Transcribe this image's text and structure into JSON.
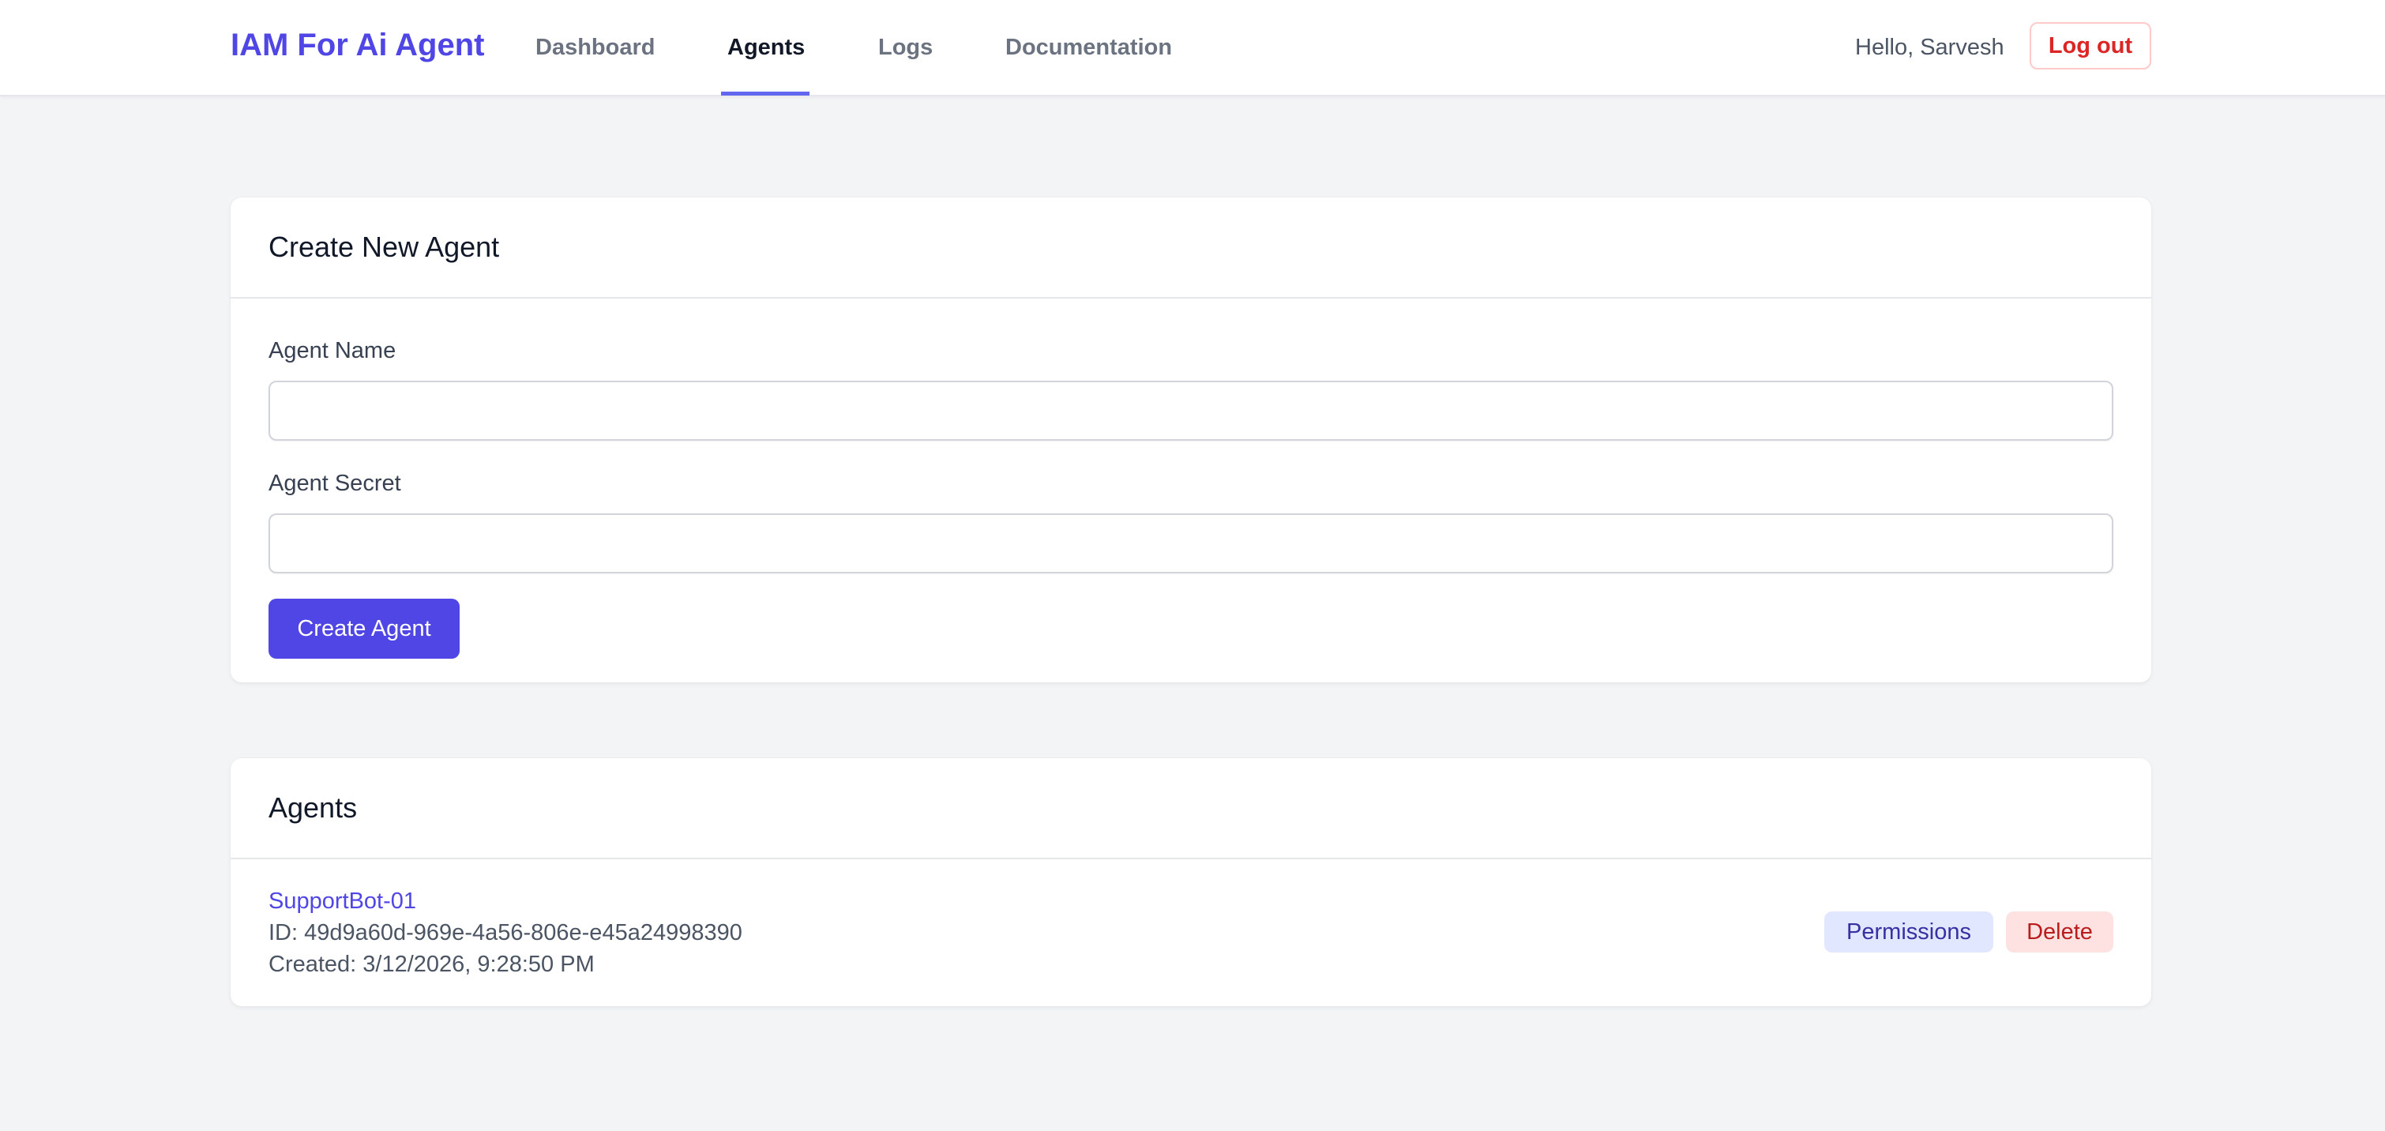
{
  "navbar": {
    "brand": "IAM For Ai Agent",
    "links": [
      {
        "label": "Dashboard",
        "active": false
      },
      {
        "label": "Agents",
        "active": true
      },
      {
        "label": "Logs",
        "active": false
      },
      {
        "label": "Documentation",
        "active": false
      }
    ],
    "greeting": "Hello, Sarvesh",
    "logout_label": "Log out"
  },
  "create_form": {
    "title": "Create New Agent",
    "name_label": "Agent Name",
    "name_value": "",
    "secret_label": "Agent Secret",
    "secret_value": "",
    "submit_label": "Create Agent"
  },
  "agents_list": {
    "title": "Agents",
    "items": [
      {
        "name": "SupportBot-01",
        "id_text": "ID: 49d9a60d-969e-4a56-806e-e45a24998390",
        "created_text": "Created: 3/12/2026, 9:28:50 PM",
        "permissions_label": "Permissions",
        "delete_label": "Delete"
      }
    ]
  },
  "colors": {
    "brand": "#4f46e5",
    "background": "#f3f4f6",
    "danger": "#dc2626",
    "permissions_bg": "#e0e7ff",
    "delete_bg": "#fee2e2"
  }
}
